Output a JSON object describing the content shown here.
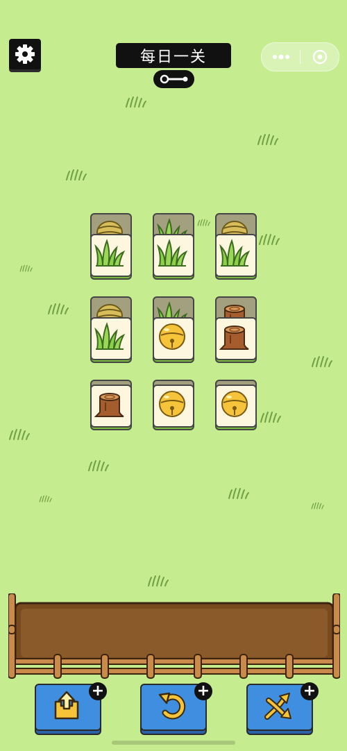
{
  "header": {
    "settings_icon": "gear-icon",
    "title": "每日一关",
    "key_icon": "key-icon",
    "capsule": {
      "more_icon": "more-dots-icon",
      "close_icon": "target-close-icon"
    }
  },
  "board": {
    "rows": [
      [
        {
          "under": "hive",
          "top": "grass"
        },
        {
          "under": "grass",
          "top": "grass"
        },
        {
          "under": "hive",
          "top": "grass"
        }
      ],
      [
        {
          "under": "hive",
          "top": "grass"
        },
        {
          "under": "grass",
          "top": "bell"
        },
        {
          "under": "stump",
          "top": "stump"
        }
      ],
      [
        {
          "under": null,
          "top": "stump"
        },
        {
          "under": null,
          "top": "bell"
        },
        {
          "under": null,
          "top": "bell"
        }
      ]
    ]
  },
  "slot_tray": {
    "slots_filled": 0
  },
  "powerups": [
    {
      "icon": "move-out-icon",
      "badge": "+"
    },
    {
      "icon": "undo-icon",
      "badge": "+"
    },
    {
      "icon": "shuffle-icon",
      "badge": "+"
    }
  ],
  "colors": {
    "background": "#c5ec8e",
    "tile_face": "#fdf7e0",
    "tile_base": "#7bbc3f",
    "button": "#3f8ee0",
    "tray": "#8b5a2b"
  }
}
